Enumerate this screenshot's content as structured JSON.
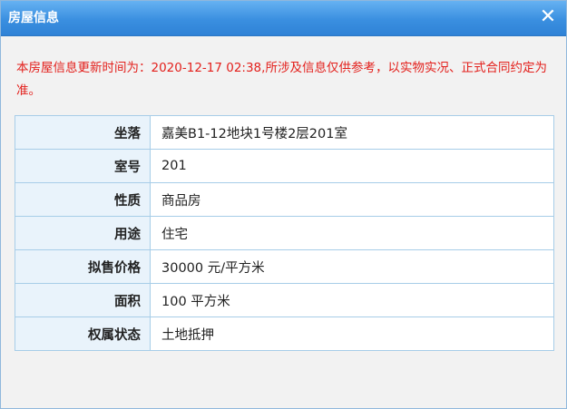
{
  "dialog": {
    "title": "房屋信息",
    "close_glyph": "✕"
  },
  "notice": "本房屋信息更新时间为：2020-12-17 02:38,所涉及信息仅供参考，以实物实况、正式合同约定为准。",
  "rows": [
    {
      "label": "坐落",
      "value": "嘉美B1-12地块1号楼2层201室"
    },
    {
      "label": "室号",
      "value": "201"
    },
    {
      "label": "性质",
      "value": "商品房"
    },
    {
      "label": "用途",
      "value": "住宅"
    },
    {
      "label": "拟售价格",
      "value": "30000 元/平方米"
    },
    {
      "label": "面积",
      "value": "100 平方米"
    },
    {
      "label": "权属状态",
      "value": "土地抵押"
    }
  ],
  "colors": {
    "titlebar": "#3a8fe0",
    "notice": "#e3201c",
    "label_bg": "#e9f3fb",
    "border": "#a7cde8"
  }
}
